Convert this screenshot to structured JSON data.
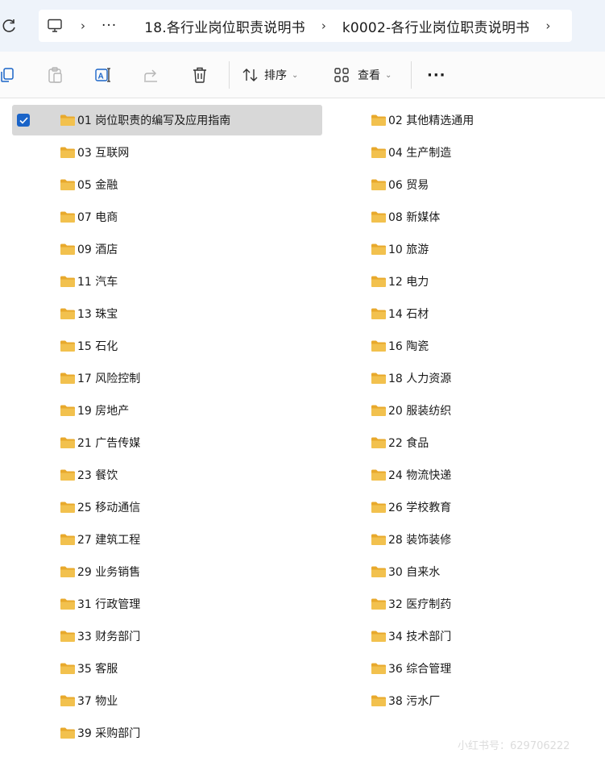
{
  "breadcrumb": {
    "overflow": "···",
    "items": [
      "18.各行业岗位职责说明书",
      "k0002-各行业岗位职责说明书"
    ]
  },
  "toolbar": {
    "sort_label": "排序",
    "view_label": "查看",
    "more_label": "···"
  },
  "folders": {
    "left": [
      "01 岗位职责的编写及应用指南",
      "03 互联网",
      "05 金融",
      "07 电商",
      "09 酒店",
      "11 汽车",
      "13 珠宝",
      "15 石化",
      "17 风险控制",
      "19 房地产",
      "21 广告传媒",
      "23 餐饮",
      "25 移动通信",
      "27 建筑工程",
      "29 业务销售",
      "31 行政管理",
      "33 财务部门",
      "35 客服",
      "37 物业",
      "39 采购部门"
    ],
    "right": [
      "02 其他精选通用",
      "04 生产制造",
      "06 贸易",
      "08 新媒体",
      "10 旅游",
      "12 电力",
      "14 石材",
      "16 陶瓷",
      "18 人力资源",
      "20 服装纺织",
      "22 食品",
      "24 物流快递",
      "26 学校教育",
      "28 装饰装修",
      "30 自来水",
      "32 医疗制药",
      "34 技术部门",
      "36 综合管理",
      "38 污水厂"
    ]
  },
  "selected_folder": "01 岗位职责的编写及应用指南",
  "watermark": "小红书号：629706222",
  "colors": {
    "accent": "#1a64c8",
    "folder": "#f2c14e",
    "selection": "#d8d8d8"
  }
}
